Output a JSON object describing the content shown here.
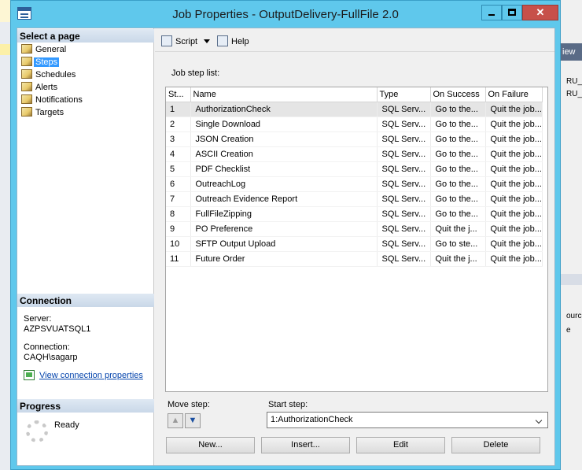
{
  "window": {
    "title": "Job Properties - OutputDelivery-FullFile 2.0",
    "minimize_glyph": "",
    "maximize_glyph": "",
    "close_glyph": "✕"
  },
  "left_pane": {
    "select_page_header": "Select a page",
    "pages": [
      {
        "label": "General",
        "selected": false
      },
      {
        "label": "Steps",
        "selected": true
      },
      {
        "label": "Schedules",
        "selected": false
      },
      {
        "label": "Alerts",
        "selected": false
      },
      {
        "label": "Notifications",
        "selected": false
      },
      {
        "label": "Targets",
        "selected": false
      }
    ],
    "connection_header": "Connection",
    "server_label": "Server:",
    "server_value": "AZPSVUATSQL1",
    "connection_label": "Connection:",
    "connection_value": "CAQH\\sagarp",
    "view_connection_link": "View connection properties",
    "progress_header": "Progress",
    "progress_status": "Ready"
  },
  "toolbar": {
    "script_label": "Script",
    "help_label": "Help"
  },
  "main": {
    "step_list_label": "Job step list:",
    "columns": [
      "St...",
      "Name",
      "Type",
      "On Success",
      "On Failure"
    ],
    "steps": [
      {
        "step": "1",
        "name": "AuthorizationCheck",
        "type": "SQL Serv...",
        "on_success": "Go to the...",
        "on_failure": "Quit the job..."
      },
      {
        "step": "2",
        "name": "Single Download",
        "type": "SQL Serv...",
        "on_success": "Go to the...",
        "on_failure": "Quit the job..."
      },
      {
        "step": "3",
        "name": "JSON Creation",
        "type": "SQL Serv...",
        "on_success": "Go to the...",
        "on_failure": "Quit the job..."
      },
      {
        "step": "4",
        "name": "ASCII Creation",
        "type": "SQL Serv...",
        "on_success": "Go to the...",
        "on_failure": "Quit the job..."
      },
      {
        "step": "5",
        "name": "PDF Checklist",
        "type": "SQL Serv...",
        "on_success": "Go to the...",
        "on_failure": "Quit the job..."
      },
      {
        "step": "6",
        "name": "OutreachLog",
        "type": "SQL Serv...",
        "on_success": "Go to the...",
        "on_failure": "Quit the job..."
      },
      {
        "step": "7",
        "name": "Outreach Evidence Report",
        "type": "SQL Serv...",
        "on_success": "Go to the...",
        "on_failure": "Quit the job..."
      },
      {
        "step": "8",
        "name": "FullFileZipping",
        "type": "SQL Serv...",
        "on_success": "Go to the...",
        "on_failure": "Quit the job..."
      },
      {
        "step": "9",
        "name": "PO Preference",
        "type": "SQL Serv...",
        "on_success": "Quit the j...",
        "on_failure": "Quit the job..."
      },
      {
        "step": "10",
        "name": "SFTP Output Upload",
        "type": "SQL Serv...",
        "on_success": "Go to ste...",
        "on_failure": "Quit the job..."
      },
      {
        "step": "11",
        "name": "Future Order",
        "type": "SQL Serv...",
        "on_success": "Quit the j...",
        "on_failure": "Quit the job..."
      }
    ],
    "selected_row": 0,
    "move_step_label": "Move step:",
    "move_up_glyph": "▲",
    "move_down_glyph": "▼",
    "start_step_label": "Start step:",
    "start_step_value": "1:AuthorizationCheck",
    "buttons": {
      "new": "New...",
      "insert": "Insert...",
      "edit": "Edit",
      "delete": "Delete"
    }
  },
  "background_app": {
    "strip_text": "iew",
    "cell1": "RU_",
    "cell2": "RU_",
    "cell3": "ource",
    "cell4": "e"
  }
}
